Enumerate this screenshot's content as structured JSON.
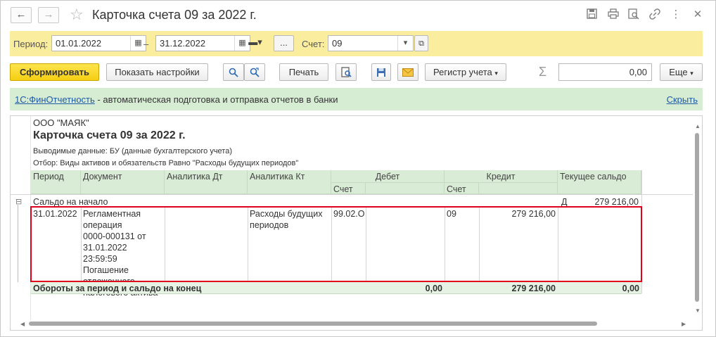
{
  "window": {
    "title": "Карточка счета 09 за 2022 г."
  },
  "period_panel": {
    "period_label": "Период:",
    "date_from": "01.01.2022",
    "dash": "–",
    "date_to": "31.12.2022",
    "ellipsis_label": "...",
    "account_label": "Счет:",
    "account_value": "09"
  },
  "toolbar": {
    "generate_label": "Сформировать",
    "show_settings_label": "Показать настройки",
    "print_label": "Печать",
    "register_label": "Регистр учета",
    "sum_value": "0,00",
    "more_label": "Еще"
  },
  "infobar": {
    "link_text": "1С:ФинОтчетность",
    "text": " - автоматическая подготовка и отправка отчетов в банки",
    "hide_label": "Скрыть"
  },
  "report": {
    "org": "ООО \"МАЯК\"",
    "title": "Карточка счета 09 за 2022 г.",
    "output_data": "Выводимые данные: БУ (данные бухгалтерского учета)",
    "filter": "Отбор: Виды активов и обязательств Равно \"Расходы будущих периодов\"",
    "headers": {
      "period": "Период",
      "document": "Документ",
      "analytics_dt": "Аналитика Дт",
      "analytics_kt": "Аналитика Кт",
      "debit": "Дебет",
      "credit": "Кредит",
      "current_balance": "Текущее сальдо",
      "debit_account": "Счет",
      "credit_account": "Счет"
    },
    "opening": {
      "label": "Сальдо на начало",
      "side": "Д",
      "amount": "279 216,00"
    },
    "row": {
      "period": "31.01.2022",
      "document_lines": [
        "Регламентная",
        "операция",
        "0000-000131 от",
        "31.01.2022 23:59:59",
        "Погашение",
        "отложенного",
        "налогового актива"
      ],
      "analytics_kt_lines": [
        "Расходы будущих",
        "периодов"
      ],
      "debit_account": "99.02.О",
      "credit_account": "09",
      "credit_amount": "279 216,00"
    },
    "totals": {
      "label": "Обороты за период и сальдо на конец",
      "debit": "0,00",
      "credit": "279 216,00",
      "balance": "0,00"
    },
    "collapse_symbol": "⊟"
  },
  "colors": {
    "period_bar": "#fbed9e",
    "info_bar": "#d6ecd3",
    "header_green": "#d9ecd5",
    "highlight": "#e0001b",
    "primary_button": "#f5cf12"
  }
}
